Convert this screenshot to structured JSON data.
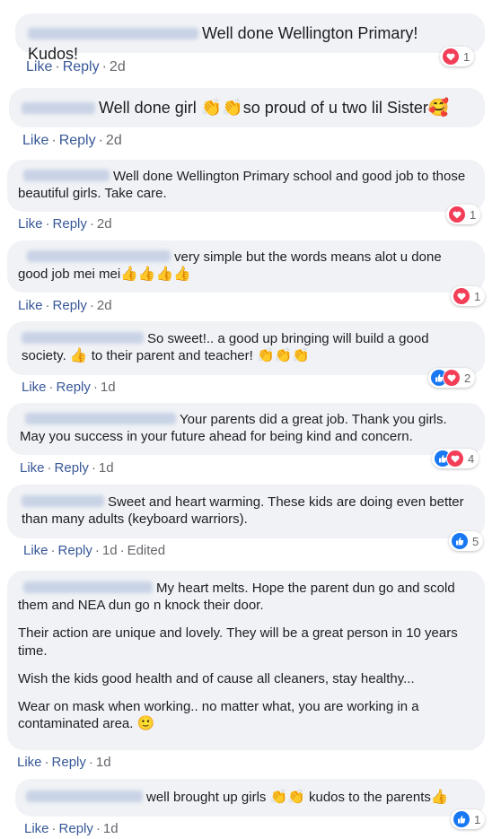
{
  "actions": {
    "like": "Like",
    "reply": "Reply",
    "sep": "·",
    "edited": "Edited"
  },
  "icons": {
    "heart": "heart-reaction-icon",
    "like": "like-reaction-icon"
  },
  "colors": {
    "bubble": "#f0f2f5",
    "link": "#385898",
    "heart": "#f33e58",
    "like": "#1877f2"
  },
  "comments": [
    {
      "text": "Well done Wellington Primary! Kudos!",
      "time": "2d",
      "reaction_count": "1"
    },
    {
      "text_a": "Well done girl ",
      "emoji_a": "👏👏",
      "text_b": "so proud of u two lil Sister",
      "emoji_b": "🥰",
      "time": "2d"
    },
    {
      "text": "Well done Wellington Primary school and good job to those beautiful girls. Take care.",
      "time": "2d",
      "reaction_count": "1"
    },
    {
      "text": "very simple but the words means alot u done good job mei mei",
      "emoji": "👍👍👍👍",
      "time": "2d",
      "reaction_count": "1"
    },
    {
      "text_a": "So sweet!.. a good up bringing will build a good society. ",
      "emoji_a": "👍",
      "text_b": " to their parent and teacher! ",
      "emoji_b": "👏👏👏",
      "time": "1d",
      "reaction_count": "2"
    },
    {
      "text": "Your parents did a great job. Thank you girls. May you success in your future ahead for being kind and concern.",
      "time": "1d",
      "reaction_count": "4"
    },
    {
      "text": "Sweet and heart warming. These kids are doing even better than many adults (keyboard warriors).",
      "time": "1d",
      "reaction_count": "5"
    },
    {
      "paragraphs": [
        "My heart melts. Hope the parent dun go and scold them and NEA dun go n knock their door.",
        "Their action are unique and lovely. They will be a great person in 10 years time.",
        "Wish the kids good health and of cause all cleaners, stay healthy...",
        "Wear on mask when working.. no matter what, you are working in a contaminated area. "
      ],
      "emoji": "🙂",
      "time": "1d"
    },
    {
      "text_a": "well brought up girls ",
      "emoji_a": "👏👏",
      "text_b": " kudos to the parents",
      "emoji_b": "👍",
      "time": "1d",
      "reaction_count": "1"
    }
  ]
}
